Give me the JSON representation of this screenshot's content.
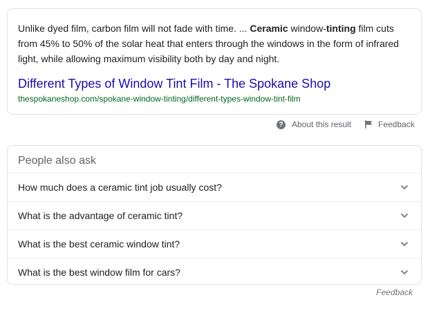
{
  "snippet": {
    "text_1": "Unlike dyed film, carbon film will not fade with time. ... ",
    "bold_1": "Ceramic",
    "text_2": " window-",
    "bold_2": "tinting",
    "text_3": " film cuts from 45% to 50% of the solar heat that enters through the windows in the form of infrared light, while allowing maximum visibility both by day and night.",
    "title": "Different Types of Window Tint Film - The Spokane Shop",
    "url": "thespokaneshop.com/spokane-window-tinting/different-types-window-tint-film"
  },
  "meta": {
    "about_label": "About this result",
    "feedback_label": "Feedback",
    "about_icon": "question-circle-icon",
    "feedback_icon": "flag-icon"
  },
  "people_also_ask": {
    "heading": "People also ask",
    "questions": [
      "How much does a ceramic tint job usually cost?",
      "What is the advantage of ceramic tint?",
      "What is the best ceramic window tint?",
      "What is the best window film for cars?"
    ],
    "expand_icon": "chevron-down-icon"
  },
  "footer": {
    "feedback_label": "Feedback"
  },
  "colors": {
    "link": "#1a0dab",
    "url": "#006621",
    "text": "#202124",
    "muted": "#5f6368"
  }
}
